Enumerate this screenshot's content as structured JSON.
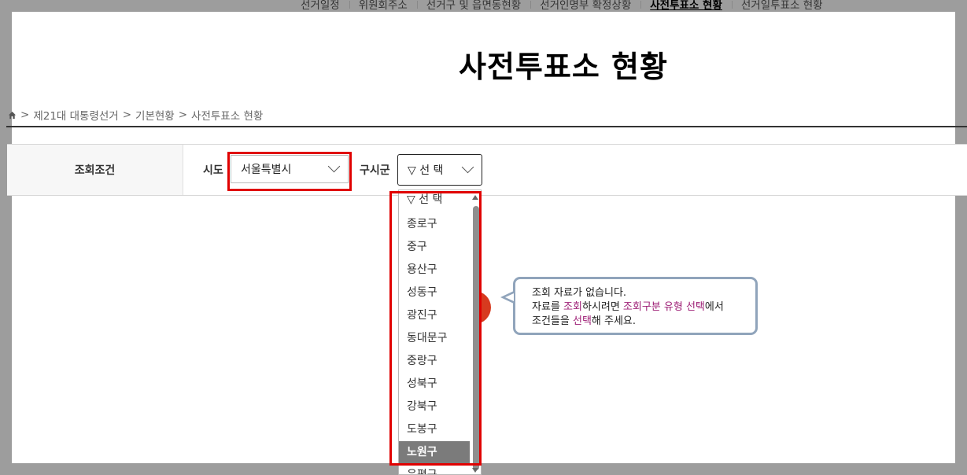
{
  "topnav": {
    "items": [
      "선거일정",
      "위원회주소",
      "선거구 및 읍면동현황",
      "선거인명부 확정상황",
      "사전투표소 현황",
      "선거일투표소 현황"
    ],
    "active_index": 4
  },
  "page_title": "사전투표소 현황",
  "breadcrumb": {
    "home_icon": "home-icon",
    "items": [
      "제21대 대통령선거",
      "기본현황",
      "사전투표소 현황"
    ],
    "separator": ">"
  },
  "filter": {
    "section_label": "조회조건",
    "sido_label": "시도",
    "sido_value": "서울특별시",
    "gusigun_label": "구시군",
    "gusigun_value": "▽ 선 택"
  },
  "dropdown": {
    "options": [
      "▽ 선 택",
      "종로구",
      "중구",
      "용산구",
      "성동구",
      "광진구",
      "동대문구",
      "중랑구",
      "성북구",
      "강북구",
      "도봉구",
      "노원구",
      "은평구"
    ],
    "highlighted": "노원구"
  },
  "tooltip": {
    "line1": "조회 자료가 없습니다.",
    "line2_a": "자료를 ",
    "line2_b": "조회",
    "line2_c": "하시려면 ",
    "line2_d": "조회구분 유형 선택",
    "line2_e": "에서",
    "line3_a": "조건들을 ",
    "line3_b": "선택",
    "line3_c": "해 주세요."
  },
  "colors": {
    "highlight_border": "#e00000",
    "tooltip_accent": "#9c1c74",
    "tooltip_border": "#90a4bb",
    "selected_option_bg": "#7b7b7b"
  }
}
